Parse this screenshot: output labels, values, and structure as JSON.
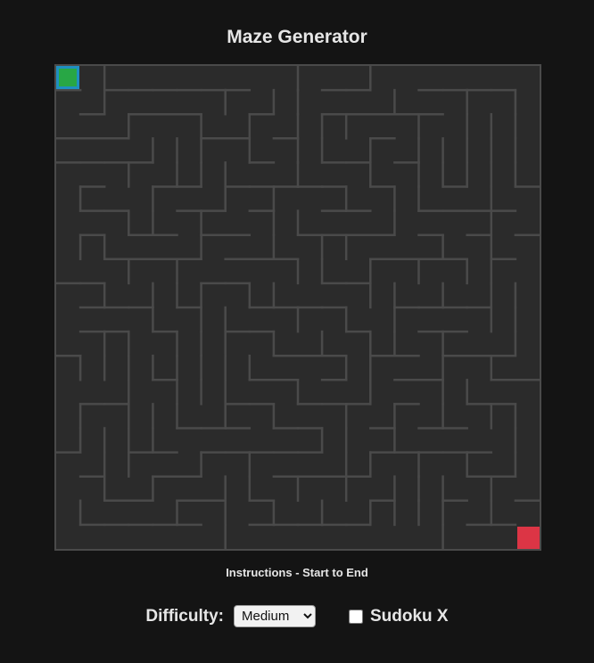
{
  "page": {
    "title": "Maze Generator",
    "instructions": "Instructions - Start to End"
  },
  "controls": {
    "difficulty_label": "Difficulty:",
    "difficulty_selected": "Medium",
    "difficulty_options": [
      "Medium"
    ],
    "sudoku_label": "Sudoku X",
    "sudoku_checked": false
  },
  "maze": {
    "rows": 20,
    "cols": 20,
    "start": "green",
    "end": "red"
  },
  "colors": {
    "background": "#141414",
    "board": "#2b2b2b",
    "wall": "#4a4a4a",
    "start": "#28a745",
    "end": "#dc3545",
    "text": "#e6e6e6"
  }
}
